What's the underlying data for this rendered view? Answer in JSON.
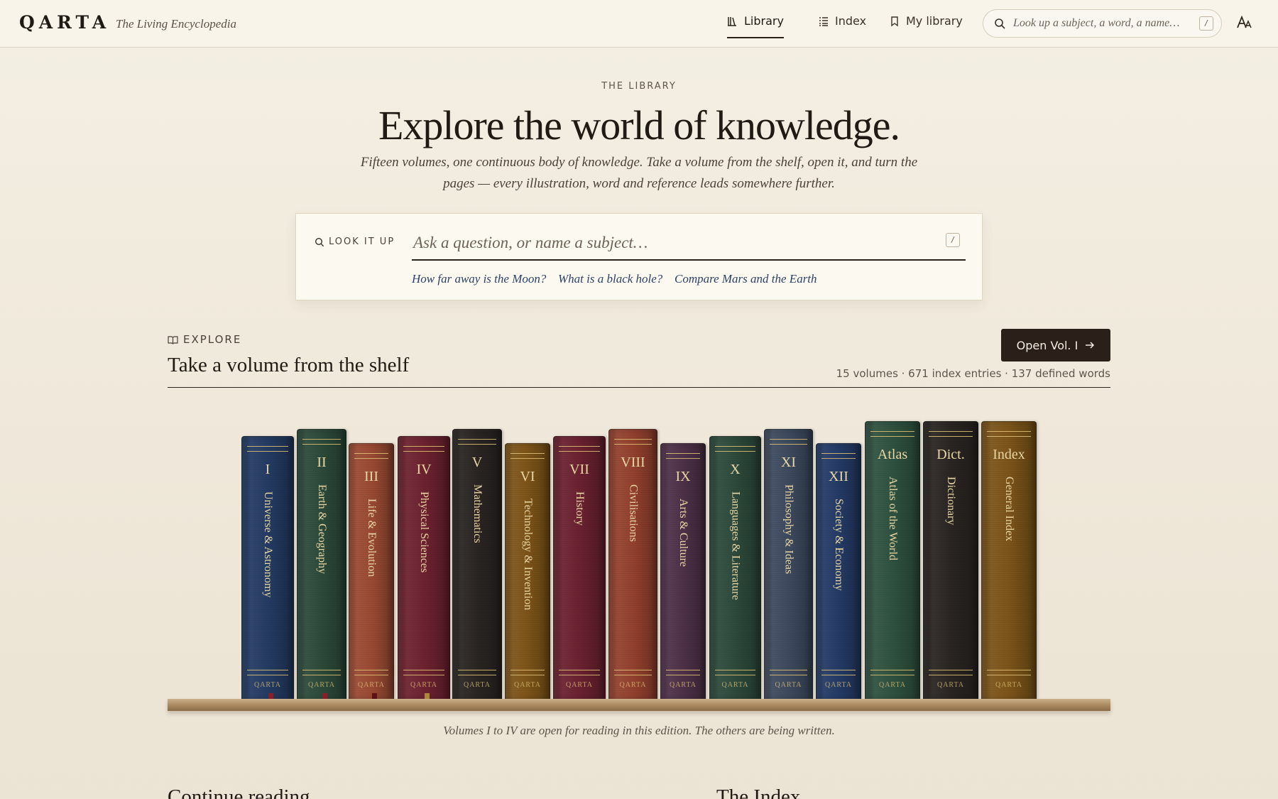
{
  "header": {
    "brand": "QARTA",
    "tagline": "The Living Encyclopedia",
    "nav": [
      {
        "label": "Library",
        "icon": "library-icon",
        "active": true
      },
      {
        "label": "Index",
        "icon": "list-icon",
        "active": false
      },
      {
        "label": "My library",
        "icon": "bookmark-icon",
        "active": false
      }
    ],
    "search_placeholder": "Look up a subject, a word, a name…",
    "search_shortcut": "/",
    "font_button_label": "AA"
  },
  "hero": {
    "eyebrow": "THE LIBRARY",
    "title": "Explore the world of knowledge.",
    "subtitle": "Fifteen volumes, one continuous body of knowledge. Take a volume from the shelf, open it, and turn the pages — every illustration, word and reference leads somewhere further."
  },
  "lookup": {
    "label": "LOOK IT UP",
    "placeholder": "Ask a question, or name a subject…",
    "shortcut": "/",
    "suggestions": [
      "How far away is the Moon?",
      "What is a black hole?",
      "Compare Mars and the Earth"
    ]
  },
  "explore": {
    "eyebrow": "EXPLORE",
    "title": "Take a volume from the shelf",
    "open_button": "Open Vol. I",
    "stats": "15 volumes · 671 index entries · 137 defined words",
    "caption": "Volumes I to IV are open for reading in this edition. The others are being written.",
    "book_brand": "QARTA",
    "volumes": [
      {
        "numeral": "I",
        "title": "Universe & Astronomy",
        "color": "#243b63",
        "ribbon": "#8a1f2a"
      },
      {
        "numeral": "II",
        "title": "Earth & Geography",
        "color": "#2c4a3a",
        "ribbon": "#8a1f2a"
      },
      {
        "numeral": "III",
        "title": "Life & Evolution",
        "color": "#9a4a33",
        "ribbon": "#5e1218"
      },
      {
        "numeral": "IV",
        "title": "Physical Sciences",
        "color": "#6e2230",
        "ribbon": "#b08a3a"
      },
      {
        "numeral": "V",
        "title": "Mathematics",
        "color": "#2a2522",
        "ribbon": ""
      },
      {
        "numeral": "VI",
        "title": "Technology & Invention",
        "color": "#7d5418",
        "ribbon": ""
      },
      {
        "numeral": "VII",
        "title": "History",
        "color": "#6b2130",
        "ribbon": ""
      },
      {
        "numeral": "VIII",
        "title": "Civilisations",
        "color": "#94412e",
        "ribbon": ""
      },
      {
        "numeral": "IX",
        "title": "Arts & Culture",
        "color": "#4e3148",
        "ribbon": ""
      },
      {
        "numeral": "X",
        "title": "Languages & Literature",
        "color": "#2d4a3c",
        "ribbon": ""
      },
      {
        "numeral": "XI",
        "title": "Philosophy & Ideas",
        "color": "#3d4a5e",
        "ribbon": ""
      },
      {
        "numeral": "XII",
        "title": "Society & Economy",
        "color": "#243b66",
        "ribbon": ""
      },
      {
        "numeral": "Atlas",
        "title": "Atlas of the World",
        "color": "#2f5240",
        "ribbon": ""
      },
      {
        "numeral": "Dict.",
        "title": "Dictionary",
        "color": "#2a2522",
        "ribbon": ""
      },
      {
        "numeral": "Index",
        "title": "General Index",
        "color": "#7c5419",
        "ribbon": ""
      }
    ]
  },
  "below": {
    "left_heading": "Continue reading",
    "right_heading": "The Index"
  }
}
